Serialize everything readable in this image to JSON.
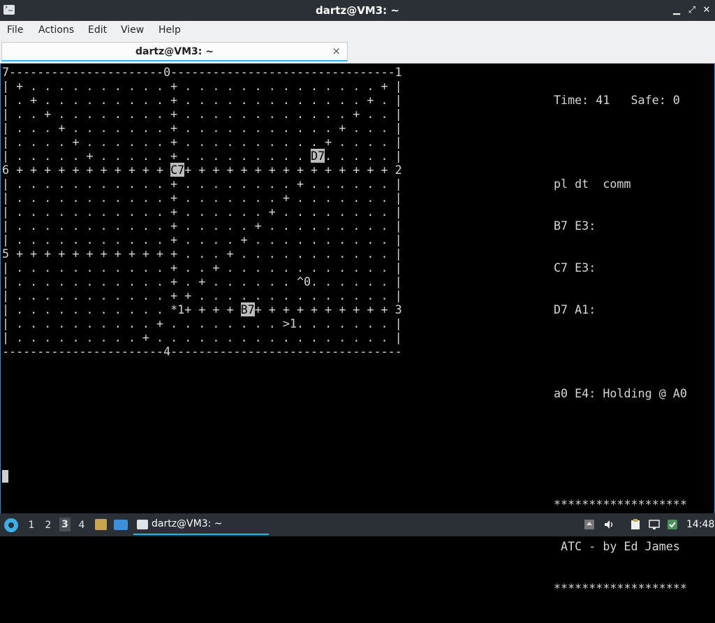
{
  "window": {
    "title": "dartz@VM3: ~",
    "controls": [
      "minimize",
      "maximize",
      "close"
    ]
  },
  "menu": [
    "File",
    "Actions",
    "Edit",
    "View",
    "Help"
  ],
  "tab": {
    "label": "dartz@VM3: ~",
    "close_glyph": "×"
  },
  "game": {
    "board": [
      "7----------------------0--------------------------------1",
      "| + . . . . . . . . . . + . . . . . . . . . . . . . . + |",
      "| . + . . . . . . . . . + . . . . . . . . . . . . . + . |",
      "| . . + . . . . . . . . + . . . . . . . . . . . . + . . |",
      "| . . . + . . . . . . . + . . . . . . . . . . . + . . . |",
      "| . . . . + . . . . . . + . . . . . . . . . . + . . . . |",
      "| . . . . . + . . . . . + . . . . . . . . . D7. . . . . |",
      "6 + + + + + + + + + + + C7+ + + + + + + + + + + + + + + 2",
      "| . . . . . . . . . . . + . . . . . . . . + . . . . . . |",
      "| . . . . . . . . . . . + . . . . . . . + . . . . . . . |",
      "| . . . . . . . . . . . + . . . . . . + . . . . . . . . |",
      "| . . . . . . . . . . . + . . . . . + . . . . . . . . . |",
      "| . . . . . . . . . . . + . . . . + . . . . . . . . . . |",
      "5 + + + + + + + + + + + + . . . + . . . . . . . . . . . |",
      "| . . . . . . . . . . . + . . + . . . . . . . . . . . . |",
      "| . . . . . . . . . . . + . + . . . . . . ^0. . . . . . |",
      "| . . . . . . . . . . . + + . . . . . . . . . . . . . . |",
      "| . . . . . . . . . . . *1+ + + + B7+ + + + + + + + + + 3",
      "| . . . . . . . . . . + . . . . . . . . >1. . . . . . . |",
      "| . . . . . . . . . + . . . . . . . . . . . . . . . . . |",
      "-----------------------4---------------------------------"
    ],
    "highlights": [
      "D7",
      "C7",
      "B7"
    ],
    "status": {
      "time_label": "Time:",
      "time": "41",
      "safe_label": "Safe:",
      "safe": "0"
    },
    "plane_table": {
      "header": "pl dt  comm",
      "rows": [
        "B7 E3:",
        "C7 E3:",
        "D7 A1:"
      ],
      "extra": "a0 E4: Holding @ A0"
    },
    "credits": {
      "stars": "*******************",
      "text": " ATC - by Ed James"
    }
  },
  "taskbar": {
    "workspaces": [
      "1",
      "2",
      "3",
      "4"
    ],
    "active_workspace": "3",
    "task_label": "dartz@VM3: ~",
    "clock": "14:48"
  },
  "colors": {
    "accent": "#3daee9",
    "panel": "#2b2f36",
    "menubar": "#eff0f1",
    "terminal_bg": "#000000",
    "terminal_fg": "#d6d6d6"
  }
}
